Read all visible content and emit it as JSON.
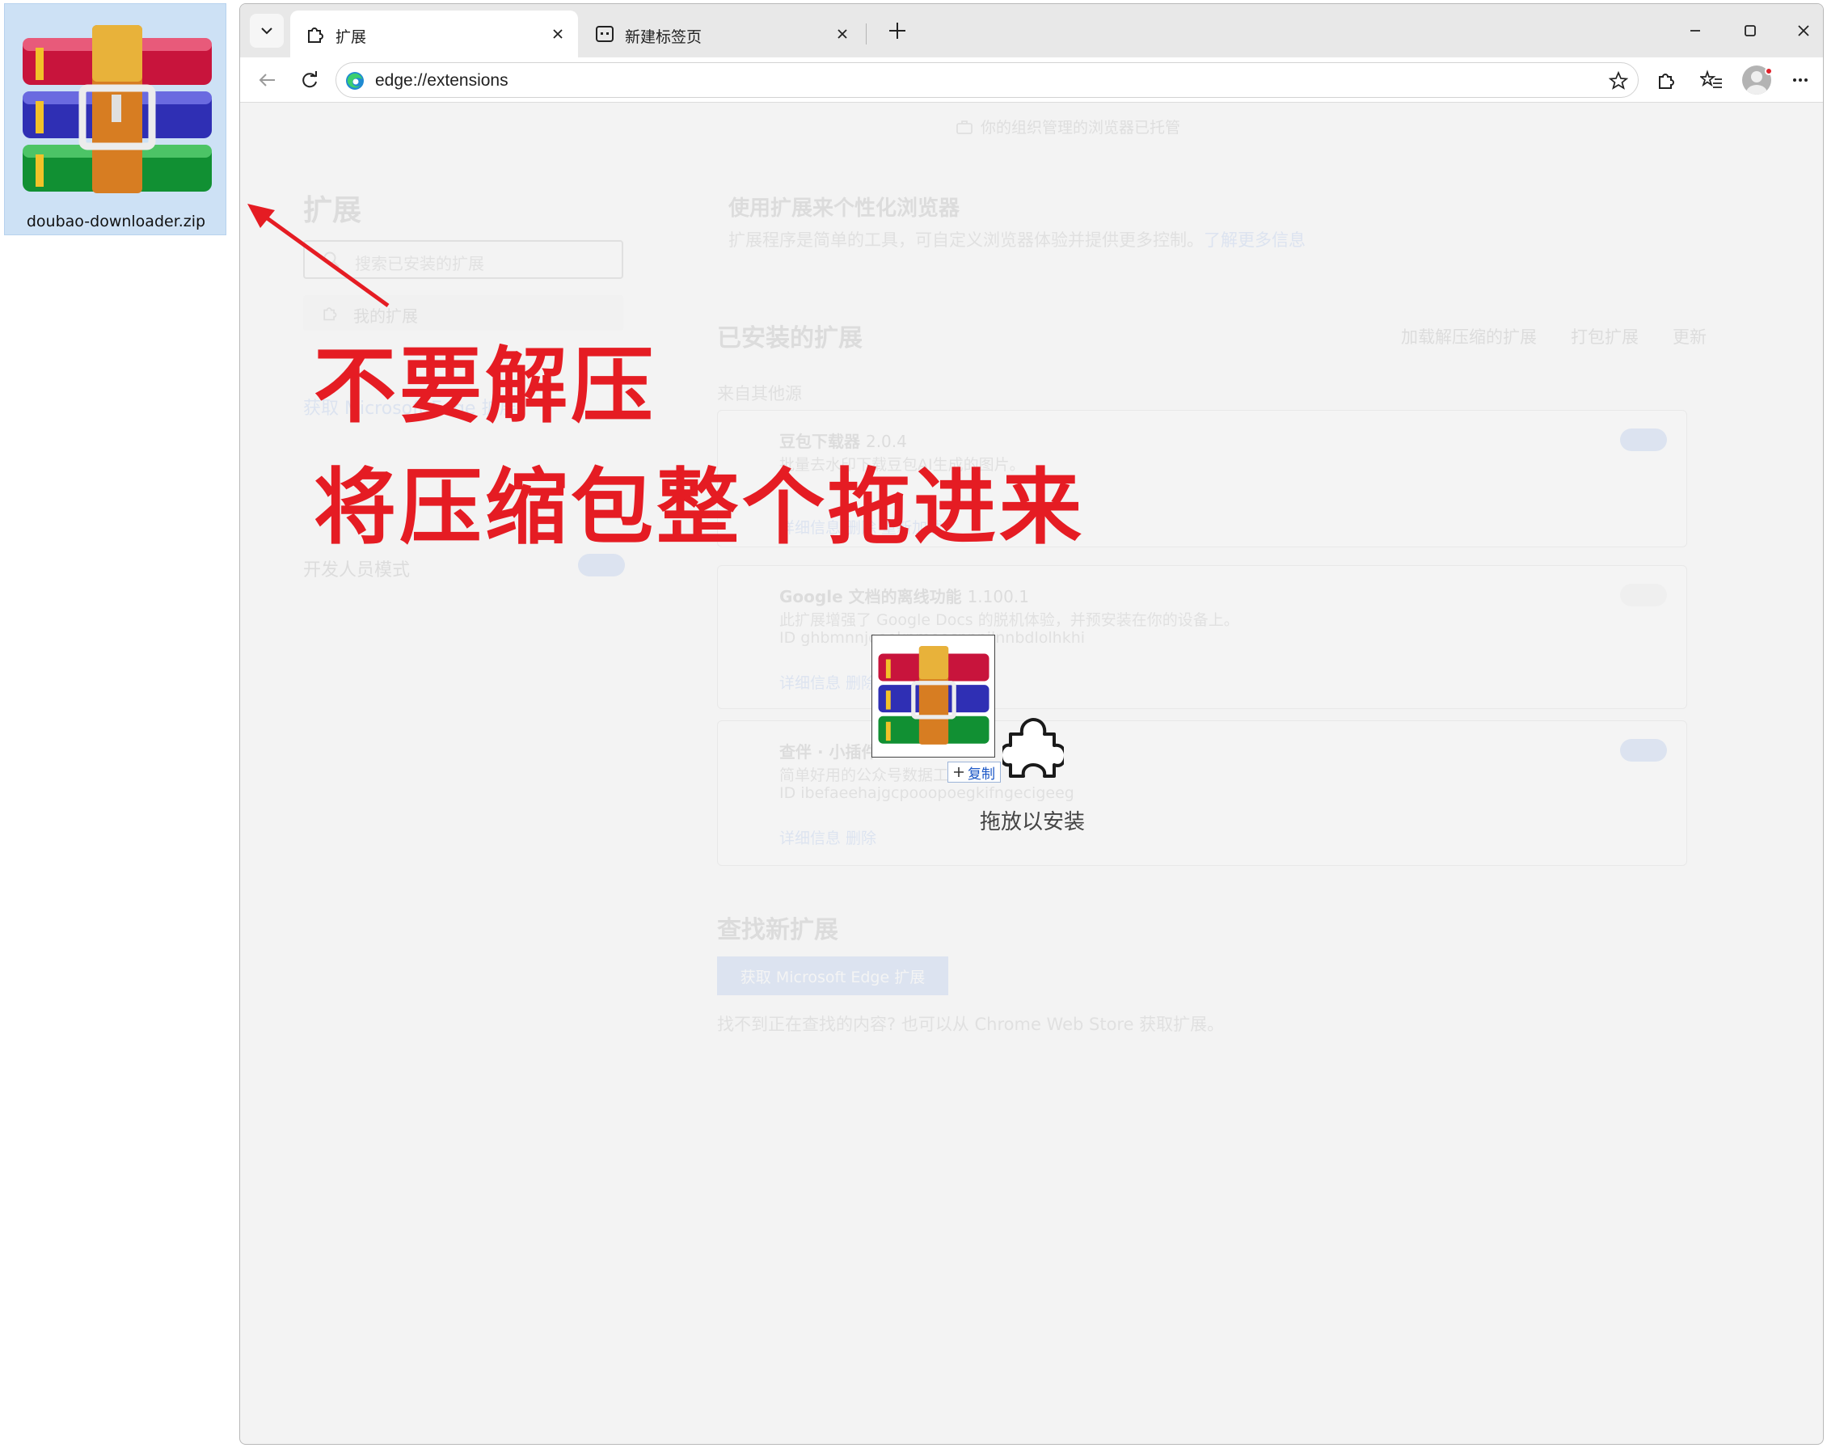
{
  "desktop": {
    "file": {
      "name": "doubao-downloader.zip",
      "icon": "winrar-archive-icon"
    }
  },
  "browser": {
    "tabs": [
      {
        "title": "扩展",
        "icon": "puzzle-icon",
        "active": true
      },
      {
        "title": "新建标签页",
        "icon": "new-tab-page-icon",
        "active": false
      }
    ],
    "address": {
      "url": "edge://extensions"
    },
    "colors": {
      "accent": "#0b57d0",
      "annotation": "#e51c23",
      "overlay": "#f3f3f3"
    }
  },
  "page": {
    "managed_note": "你的组织管理的浏览器已托管",
    "title": "扩展",
    "search_placeholder": "搜索已安装的扩展",
    "nav_my_extensions": "我的扩展",
    "get_extensions_link": "获取 Microsoft Edge 扩展",
    "developer_mode": "开发人员模式",
    "banner_title": "使用扩展来个性化浏览器",
    "banner_text": "扩展程序是简单的工具，可自定义浏览器体验并提供更多控制。",
    "banner_link": "了解更多信息",
    "installed_title": "已安装的扩展",
    "actions": {
      "load_unpacked": "加载解压缩的扩展",
      "pack": "打包扩展",
      "update": "更新"
    },
    "other_sources": "来自其他源",
    "extensions": [
      {
        "name": "豆包下载器",
        "version": "2.0.4",
        "desc": "批量去水印下载豆包AI生成的图片。",
        "id": "",
        "links": "详细信息   删除   重新加载",
        "enabled": true
      },
      {
        "name": "Google 文档的离线功能",
        "version": "1.100.1",
        "desc": "此扩展增强了 Google Docs 的脱机体验，并预安装在你的设备上。",
        "id": "ID ghbmnnjooekpmoecnnnilnnbdlolhkhi",
        "links": "详细信息   删除",
        "enabled": false
      },
      {
        "name": "查伴 · 小插件",
        "version": "",
        "desc": "简单好用的公众号数据工具",
        "id": "ID ibefaeehajgcpooopoegkifngecigeeg",
        "links": "详细信息   删除",
        "enabled": true
      }
    ],
    "find_title": "查找新扩展",
    "find_button": "获取 Microsoft Edge 扩展",
    "find_note": "找不到正在查找的内容? 也可以从 Chrome Web Store 获取扩展。"
  },
  "drag": {
    "copy_label": "复制",
    "drop_label": "拖放以安装"
  },
  "annotations": {
    "line1": "不要解压",
    "line2": "将压缩包整个拖进来"
  }
}
